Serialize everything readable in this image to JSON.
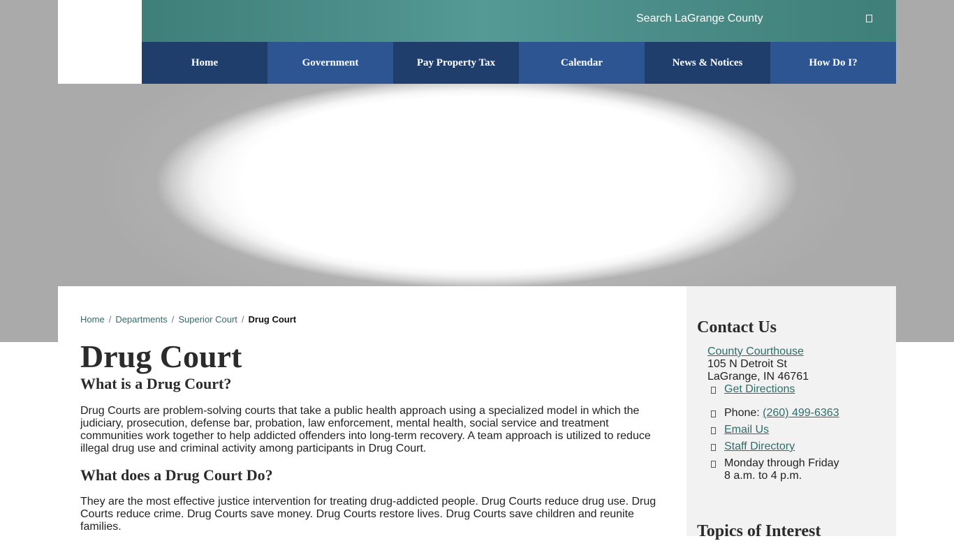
{
  "header": {
    "search_label": "Search LaGrange County"
  },
  "nav": {
    "items": [
      {
        "label": "Home"
      },
      {
        "label": "Government"
      },
      {
        "label": "Pay Property Tax"
      },
      {
        "label": "Calendar"
      },
      {
        "label": "News & Notices"
      },
      {
        "label": "How Do I?"
      }
    ]
  },
  "breadcrumb": {
    "items": [
      "Home",
      "Departments",
      "Superior Court"
    ],
    "separator": "/",
    "current": "Drug Court"
  },
  "main": {
    "title": "Drug Court",
    "section1_heading": "What is a Drug Court?",
    "section1_text": "Drug Courts are problem-solving courts that take a public health approach using a specialized model in which the judiciary, prosecution, defense bar, probation, law enforcement, mental health, social service and treatment communities work together to help addicted offenders into long-term recovery. A team approach is utilized to reduce illegal drug use and criminal activity among participants in Drug Court.",
    "section2_heading": "What does a Drug Court Do?",
    "section2_text": "They are the most effective justice intervention for treating drug-addicted people. Drug Courts reduce drug use. Drug Courts reduce crime. Drug Courts save money. Drug Courts restore lives. Drug Courts save children and reunite families."
  },
  "sidebar": {
    "contact_heading": "Contact Us",
    "location_link": "County Courthouse",
    "address_line1": "105 N Detroit St",
    "address_line2": "LaGrange, IN 46761",
    "directions_link": "Get Directions",
    "phone_label": "Phone: ",
    "phone_number": "(260) 499-6363",
    "email_link": "Email Us",
    "staff_link": "Staff Directory",
    "hours_line1": "Monday through Friday",
    "hours_line2": "8 a.m. to 4 p.m.",
    "topics_heading": "Topics of Interest"
  },
  "colors": {
    "nav_dark": "#1f3e6c",
    "nav_light": "#2d5592",
    "topbar_teal": "#4a8c87",
    "link_teal": "#2c6e6b",
    "sidebar_bg": "#f2f2f2"
  },
  "icons": {
    "search": "search-icon",
    "list_bullet": "box-icon"
  }
}
